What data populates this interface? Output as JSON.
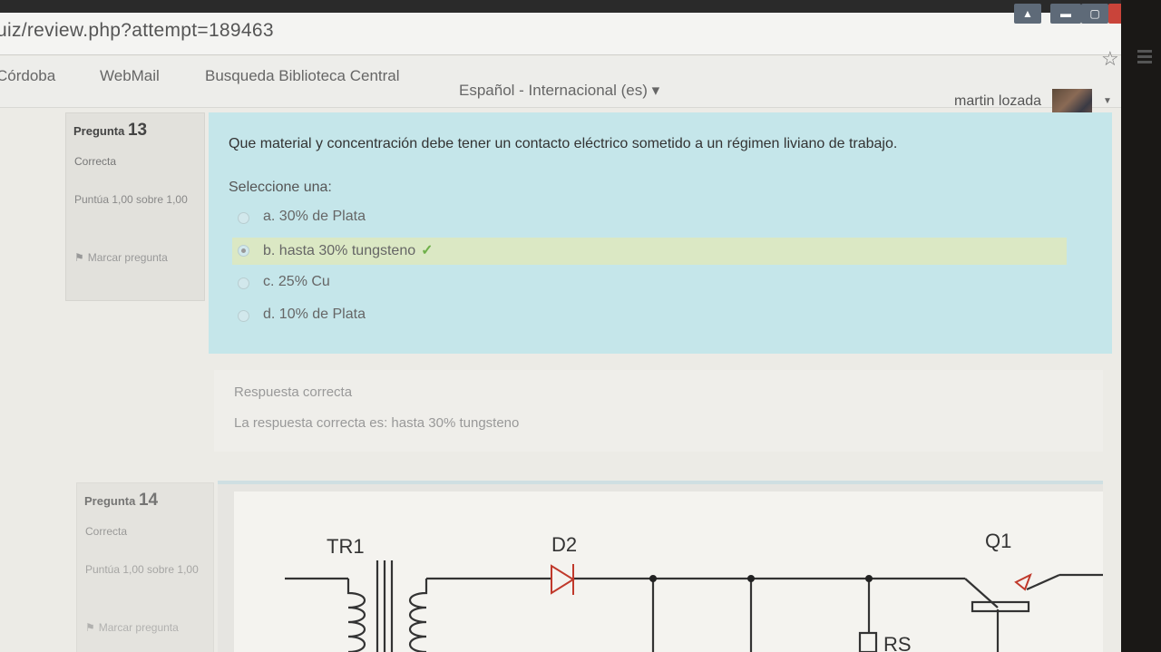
{
  "browser": {
    "url": "uiz/review.php?attempt=189463"
  },
  "nav": {
    "links": [
      "Córdoba",
      "WebMail",
      "Busqueda Biblioteca Central"
    ],
    "language": "Español - Internacional (es) ▾",
    "user_name": "martin lozada"
  },
  "question13": {
    "label": "Pregunta",
    "number": "13",
    "state": "Correcta",
    "grade": "Puntúa 1,00 sobre 1,00",
    "flag": "Marcar pregunta",
    "text": "Que material y concentración debe tener un contacto eléctrico sometido a un régimen liviano de trabajo.",
    "prompt": "Seleccione una:",
    "options": [
      {
        "label": "a. 30% de Plata"
      },
      {
        "label": "b. hasta 30% tungsteno"
      },
      {
        "label": "c. 25% Cu"
      },
      {
        "label": "d. 10% de Plata"
      }
    ],
    "selected_option": "b",
    "feedback_result": "Respuesta correcta",
    "feedback_answer": "La respuesta correcta es: hasta 30% tungsteno"
  },
  "question14": {
    "label": "Pregunta",
    "number": "14",
    "state": "Correcta",
    "grade": "Puntúa 1,00 sobre 1,00",
    "flag": "Marcar pregunta",
    "circuit_labels": {
      "transformer": "TR1",
      "diode": "D2",
      "transistor": "Q1",
      "resistor": "RS"
    }
  },
  "colors": {
    "question_bg": "#c5e6ea",
    "correct_highlight": "#dbe8c4",
    "check_green": "#6fb04a"
  }
}
